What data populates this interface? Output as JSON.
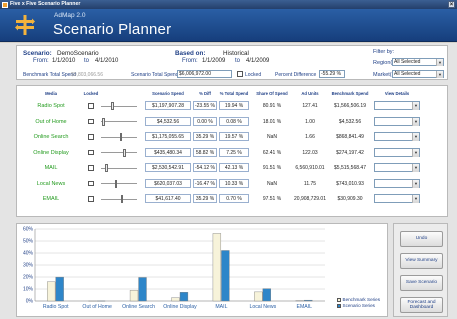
{
  "window": {
    "title": "Five x Five Scenario Planner"
  },
  "header": {
    "brand_small": "AdMap 2.0",
    "brand_big": "Scenario Planner"
  },
  "scenario": {
    "label": "Scenario:",
    "name": "DemoScenario",
    "from_label": "From:",
    "from": "1/1/2010",
    "to_label": "to",
    "to": "4/1/2010"
  },
  "based_on": {
    "label": "Based on:",
    "name": "Historical",
    "from_label": "From:",
    "from": "1/1/2009",
    "to_label": "to",
    "to": "4/1/2009"
  },
  "totals": {
    "benchmark_label": "Benchmark Total Spend",
    "benchmark_value": "$9,803,066.56",
    "scenario_label": "Scenario Total Spend",
    "scenario_value": "$6,006,972.00",
    "locked_label": "Locked",
    "locked": false,
    "pct_diff_label": "Percent Difference",
    "pct_diff_value": "-55.29 %"
  },
  "filter": {
    "title": "Filter by:",
    "region_label": "Region(s)",
    "region_value": "All Selected",
    "market_label": "Market(s)",
    "market_value": "All Selected"
  },
  "table": {
    "headers": [
      "Media",
      "Locked",
      "Scenario Spend",
      "% Diff",
      "% Total Spend",
      "Share Of Spend",
      "Ad Units",
      "Benchmark Spend",
      "View Details"
    ],
    "rows": [
      {
        "media": "Radio Spot",
        "locked": false,
        "slider": 0.3,
        "scenario_spend": "$1,197,907.28",
        "pct_diff": "-23.55 %",
        "pct_total": "19.94 %",
        "share": "80.91 %",
        "ad_units": "127.41",
        "benchmark": "$1,566,506.19",
        "details": ""
      },
      {
        "media": "Out of Home",
        "locked": false,
        "slider": 0.03,
        "scenario_spend": "$4,532.56",
        "pct_diff": "0.00 %",
        "pct_total": "0.08 %",
        "share": "18.01 %",
        "ad_units": "1.00",
        "benchmark": "$4,532.56",
        "details": ""
      },
      {
        "media": "Online Search",
        "locked": false,
        "slider": 0.55,
        "scenario_spend": "$1,175,055.65",
        "pct_diff": "35.29 %",
        "pct_total": "19.57 %",
        "share": "NaN",
        "ad_units": "1.66",
        "benchmark": "$868,841.49",
        "details": ""
      },
      {
        "media": "Online Display",
        "locked": false,
        "slider": 0.65,
        "scenario_spend": "$435,480.34",
        "pct_diff": "58.82 %",
        "pct_total": "7.25 %",
        "share": "62.41 %",
        "ad_units": "122.03",
        "benchmark": "$274,197.42",
        "details": ""
      },
      {
        "media": "MAIL",
        "locked": false,
        "slider": 0.12,
        "scenario_spend": "$2,530,542.91",
        "pct_diff": "-54.12 %",
        "pct_total": "42.13 %",
        "share": "91.51 %",
        "ad_units": "6,560,910.01",
        "benchmark": "$5,515,568.47",
        "details": ""
      },
      {
        "media": "Local News",
        "locked": false,
        "slider": 0.4,
        "scenario_spend": "$620,037.03",
        "pct_diff": "-16.47 %",
        "pct_total": "10.33 %",
        "share": "NaN",
        "ad_units": "11.75",
        "benchmark": "$743,010.93",
        "details": ""
      },
      {
        "media": "EMAIL",
        "locked": false,
        "slider": 0.58,
        "scenario_spend": "$41,617.40",
        "pct_diff": "35.29 %",
        "pct_total": "0.70 %",
        "share": "97.51 %",
        "ad_units": "20,908,729.01",
        "benchmark": "$30,909.30",
        "details": ""
      }
    ]
  },
  "chart_data": {
    "type": "bar",
    "categories": [
      "Radio Spot",
      "Out of Home",
      "Online Search",
      "Online Display",
      "MAIL",
      "Local News",
      "EMAIL"
    ],
    "series": [
      {
        "name": "Benchmark Series",
        "color": "#f7f3da",
        "values": [
          16,
          0.05,
          8.9,
          2.8,
          56.3,
          7.6,
          0.3
        ]
      },
      {
        "name": "Scenario Series",
        "color": "#2e86c9",
        "values": [
          19.9,
          0.08,
          19.6,
          7.25,
          42.1,
          10.3,
          0.7
        ]
      }
    ],
    "ylim": [
      0,
      60
    ],
    "yticks": [
      "0%",
      "10%",
      "20%",
      "30%",
      "40%",
      "50%",
      "60%"
    ],
    "grid": true,
    "legend_position": "right"
  },
  "actions": {
    "undo": "Undo",
    "view_summary": "View Summary",
    "save_scenario": "Save Scenario",
    "forecast": "Forecast and Dashboard"
  }
}
